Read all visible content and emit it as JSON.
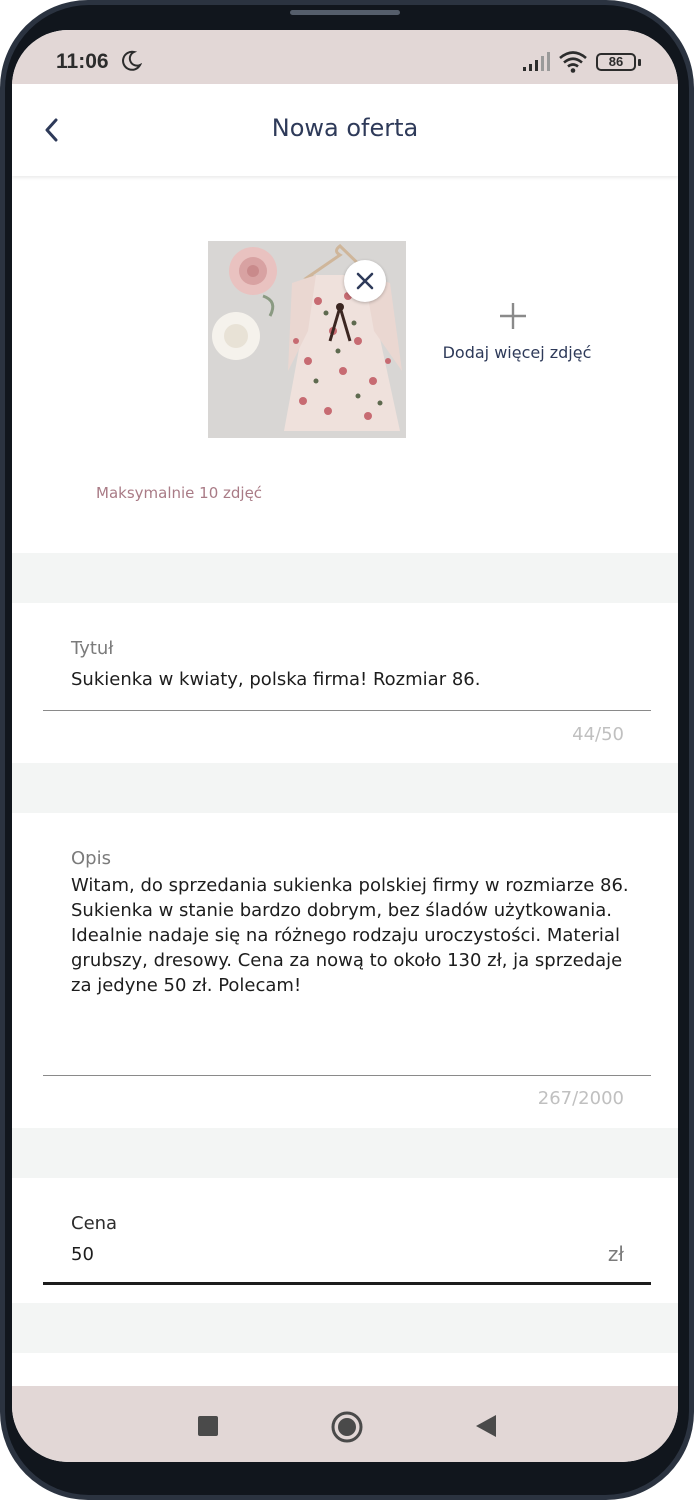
{
  "status_bar": {
    "time": "11:06",
    "battery": "86",
    "icons": [
      "moon-icon",
      "signal-icon",
      "wifi-icon",
      "battery-icon"
    ]
  },
  "app_bar": {
    "title": "Nowa oferta",
    "back_icon": "chevron-left-icon"
  },
  "photos": {
    "add_more_label": "Dodaj więcej zdjęć",
    "max_note": "Maksymalnie 10 zdjęć",
    "remove_icon": "close-icon"
  },
  "form": {
    "title": {
      "label": "Tytuł",
      "value": "Sukienka w kwiaty, polska firma! Rozmiar 86.",
      "counter": "44/50"
    },
    "description": {
      "label": "Opis",
      "value": "Witam, do sprzedania sukienka polskiej firmy w rozmiarze 86. Sukienka w stanie bardzo dobrym, bez śladów użytkowania. Idealnie nadaje się na różnego rodzaju uroczystości. Material grubszy, dresowy. Cena za nową to około 130 zł, ja sprzedaje za jedyne 50 zł. Polecam!",
      "counter": "267/2000"
    },
    "price": {
      "label": "Cena",
      "value": "50",
      "currency": "zł"
    }
  },
  "colors": {
    "status_bar_bg": "#e2d7d6",
    "title_color": "#2e3a59",
    "hint_pink": "#a97b86",
    "divider_bg": "#f3f5f4"
  },
  "nav_bar": {
    "icons": [
      "recent-apps-icon",
      "home-icon",
      "back-triangle-icon"
    ]
  }
}
